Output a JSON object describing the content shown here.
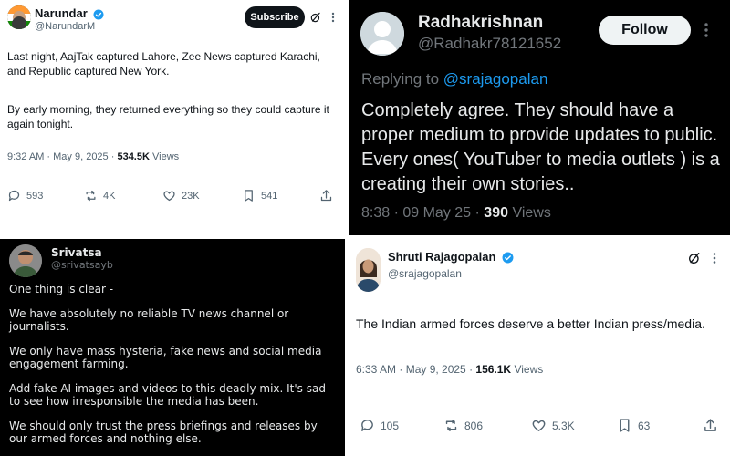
{
  "post_narundar": {
    "display_name": "Narundar",
    "handle": "@NarundarM",
    "subscribe_label": "Subscribe",
    "paragraph_1": "Last night, AajTak captured Lahore, Zee News captured Karachi, and Republic captured New York.",
    "paragraph_2": "By early morning, they returned everything so they could capture it again tonight.",
    "time": "9:32 AM · May 9, 2025 ·",
    "views_count": "534.5K",
    "views_label": "Views",
    "replies": "593",
    "reposts": "4K",
    "likes": "23K",
    "bookmarks": "541",
    "icons": [
      "grok-icon",
      "reply-icon",
      "repost-icon",
      "like-icon",
      "bookmark-icon",
      "share-icon"
    ]
  },
  "post_radhakrishnan": {
    "display_name": "Radhakrishnan",
    "handle": "@Radhakr78121652",
    "follow_label": "Follow",
    "replying_to_prefix": "Replying to",
    "replying_to_handle": "@srajagopalan",
    "text": "Completely agree. They should have a proper medium to provide updates to public. Every ones( YouTuber to media outlets ) is a creating their own stories..",
    "time": "8:38 · 09 May 25 ·",
    "views_count": "390",
    "views_label": "Views",
    "icons": [
      "more-options-icon"
    ]
  },
  "post_srivatsa": {
    "display_name": "Srivatsa",
    "handle": "@srivatsayb",
    "paragraphs": [
      "One thing is clear -",
      "We have absolutely no reliable TV news channel or journalists.",
      "We only have mass hysteria, fake news and social media engagement farming.",
      "Add fake AI images and videos to this deadly mix. It's sad to see how irresponsible the media has been.",
      "We should only trust the press briefings and releases by our armed forces and nothing else."
    ]
  },
  "post_shruti": {
    "display_name": "Shruti Rajagopalan",
    "handle": "@srajagopalan",
    "text": "The Indian armed forces deserve a better Indian press/media.",
    "time": "6:33 AM · May 9, 2025 ·",
    "views_count": "156.1K",
    "views_label": "Views",
    "replies": "105",
    "reposts": "806",
    "likes": "5.3K",
    "bookmarks": "63",
    "icons": [
      "grok-icon",
      "reply-icon",
      "repost-icon",
      "like-icon",
      "bookmark-icon",
      "share-icon"
    ]
  },
  "colors": {
    "verified_blue": "#1d9bf0",
    "link_blue": "#1d9bf0",
    "dark_bg": "#000000",
    "light_bg": "#ffffff",
    "muted_gray_light": "#536471",
    "muted_gray_dark": "#71767b"
  }
}
